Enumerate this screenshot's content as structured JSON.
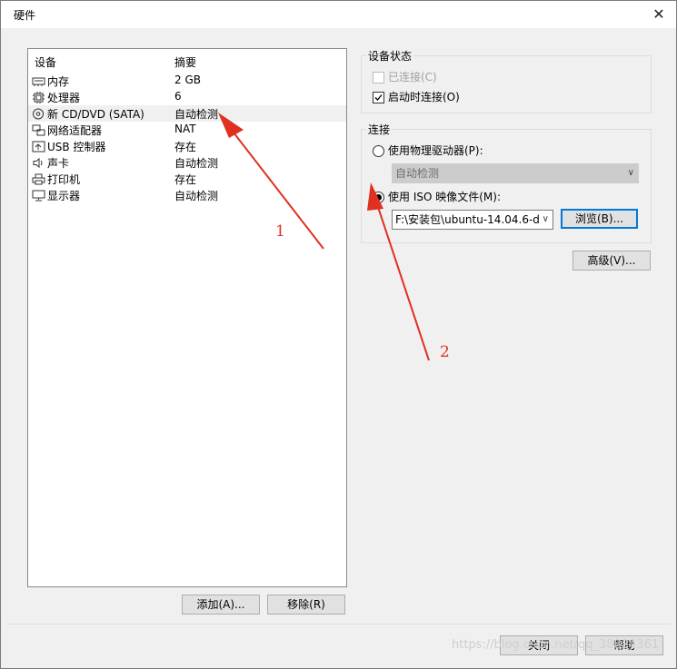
{
  "window": {
    "title": "硬件",
    "close_glyph": "✕"
  },
  "device_list": {
    "headers": {
      "device": "设备",
      "summary": "摘要"
    },
    "items": [
      {
        "name": "内存",
        "summary": "2 GB",
        "icon": "memory-icon"
      },
      {
        "name": "处理器",
        "summary": "6",
        "icon": "cpu-icon"
      },
      {
        "name": "新 CD/DVD (SATA)",
        "summary": "自动检测",
        "icon": "cd-dvd-icon",
        "selected": true
      },
      {
        "name": "网络适配器",
        "summary": "NAT",
        "icon": "network-adapter-icon"
      },
      {
        "name": "USB 控制器",
        "summary": "存在",
        "icon": "usb-icon"
      },
      {
        "name": "声卡",
        "summary": "自动检测",
        "icon": "speaker-icon"
      },
      {
        "name": "打印机",
        "summary": "存在",
        "icon": "printer-icon"
      },
      {
        "name": "显示器",
        "summary": "自动检测",
        "icon": "monitor-icon"
      }
    ],
    "add_button": "添加(A)...",
    "remove_button": "移除(R)"
  },
  "device_status": {
    "label": "设备状态",
    "connected": {
      "label": "已连接(C)",
      "checked": false,
      "disabled": true
    },
    "connect_at_power_on": {
      "label": "启动时连接(O)",
      "checked": true
    }
  },
  "connection": {
    "label": "连接",
    "physical_drive": {
      "label": "使用物理驱动器(P):",
      "selected": false,
      "value": "自动检测"
    },
    "iso_image": {
      "label": "使用 ISO 映像文件(M):",
      "selected": true,
      "value": "F:\\安装包\\ubuntu-14.04.6-d"
    },
    "browse_button": "浏览(B)..."
  },
  "advanced_button": "高级(V)...",
  "footer": {
    "close_button": "关闭",
    "help_button": "帮助"
  },
  "annotations": {
    "arrow1_label": "1",
    "arrow2_label": "2",
    "arrow_color": "#e03020"
  },
  "watermark": "https://blog.csdn.net/qq_38824361"
}
